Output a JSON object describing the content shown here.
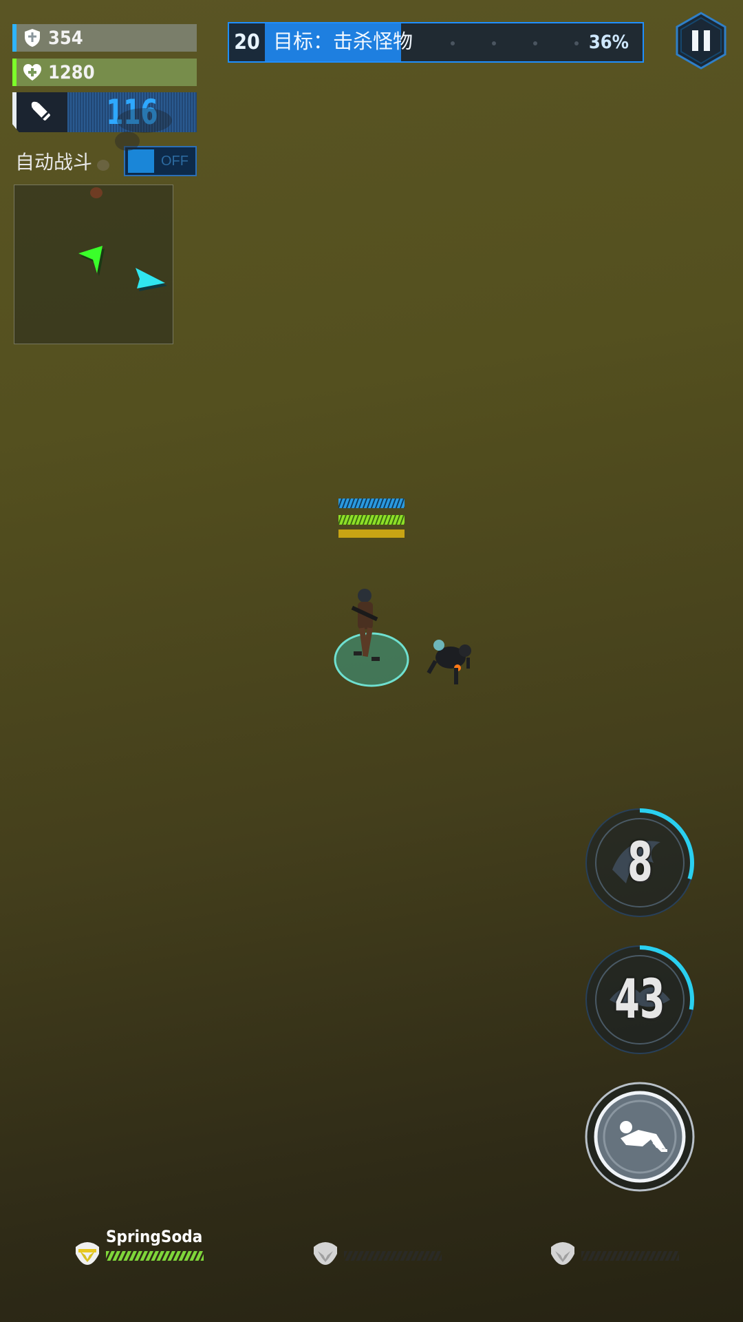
{
  "hud": {
    "armor": {
      "value": "354",
      "accent": "#2fb4ff",
      "icon": "shield-icon"
    },
    "health": {
      "value": "1280",
      "accent": "#7dff2a",
      "icon": "health-cross-icon"
    },
    "ammo": {
      "value": "116",
      "icon": "bullet-icon"
    }
  },
  "auto_battle": {
    "label": "自动战斗",
    "state_text": "OFF",
    "on": false
  },
  "mission": {
    "level": "20",
    "objective": "目标：击杀怪物",
    "progress_text": "36%",
    "progress": 0.36
  },
  "pause": {
    "icon": "pause-icon"
  },
  "skills": [
    {
      "cooldown": "8",
      "icon": "dragon-emblem-icon",
      "progress": 0.3
    },
    {
      "cooldown": "43",
      "icon": "dragon-emblem-icon",
      "progress": 0.28
    },
    {
      "cooldown": "",
      "icon": "dash-icon",
      "progress": 1
    }
  ],
  "team": [
    {
      "name": "SpringSoda",
      "active": true,
      "icon": "helmet-icon"
    },
    {
      "name": "",
      "active": false,
      "icon": "helmet-icon"
    },
    {
      "name": "",
      "active": false,
      "icon": "helmet-icon"
    }
  ],
  "colors": {
    "armor": "#2fb4ff",
    "health": "#7dff2a",
    "mission_fill": "#1e7fe0",
    "skill_ring": "#2ad0f0"
  }
}
